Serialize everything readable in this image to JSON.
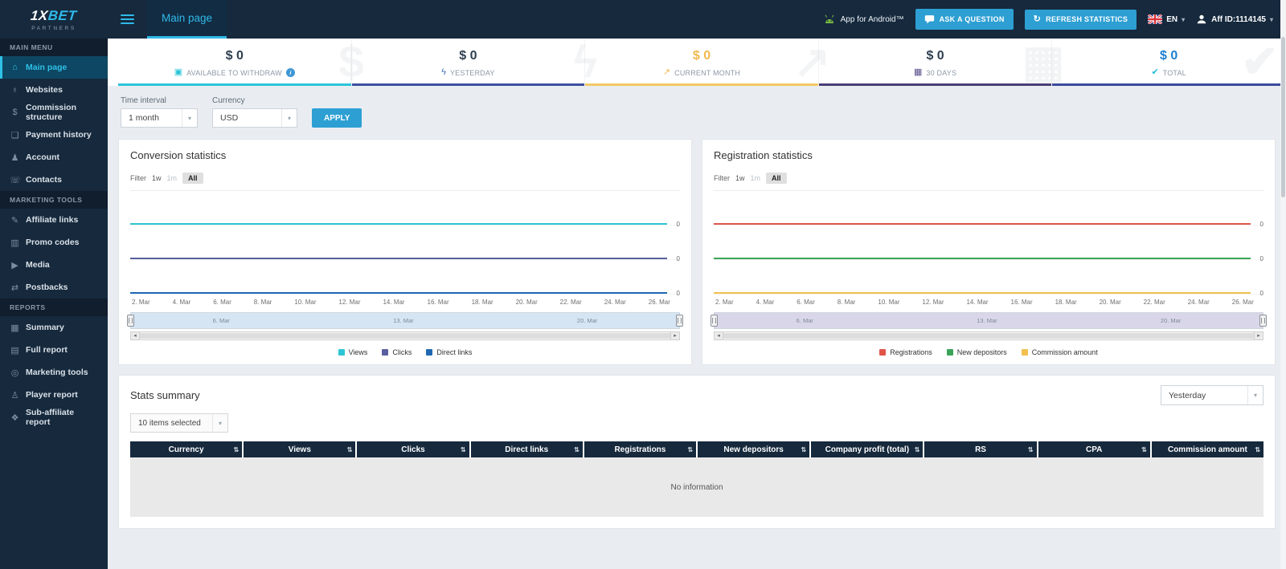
{
  "colors": {
    "accent_cyan": "#2d9fd3",
    "sidebar_bg": "#16293d",
    "active_link": "#2fc0e8",
    "page_bg": "#e9edf1"
  },
  "brand": {
    "name_a": "1X",
    "name_b": "BET",
    "subtitle": "PARTNERS"
  },
  "topbar": {
    "page_title": "Main page",
    "android_label": "App for Android™",
    "ask_question": "ASK A QUESTION",
    "refresh_statistics": "REFRESH STATISTICS",
    "language": "EN",
    "aff_id": "Aff ID:1114145"
  },
  "icons": {
    "caret": "▾",
    "refresh": "↻",
    "sort": "⇅",
    "scroll_left": "◂",
    "scroll_right": "▸"
  },
  "sidebar": {
    "sections": [
      {
        "header": "MAIN MENU",
        "items": [
          {
            "label": "Main page",
            "icon": "home-icon",
            "glyph": "⌂",
            "state": "active"
          },
          {
            "label": "Websites",
            "icon": "globe-icon",
            "glyph": "♁"
          },
          {
            "label": "Commission structure",
            "icon": "dollar-icon",
            "glyph": "$"
          },
          {
            "label": "Payment history",
            "icon": "payment-history-icon",
            "glyph": "❏"
          },
          {
            "label": "Account",
            "icon": "account-icon",
            "glyph": "♟"
          },
          {
            "label": "Contacts",
            "icon": "contacts-icon",
            "glyph": "☏"
          }
        ]
      },
      {
        "header": "MARKETING TOOLS",
        "items": [
          {
            "label": "Affiliate links",
            "icon": "affiliate-links-icon",
            "glyph": "✎"
          },
          {
            "label": "Promo codes",
            "icon": "promo-codes-icon",
            "glyph": "▥"
          },
          {
            "label": "Media",
            "icon": "media-icon",
            "glyph": "▶"
          },
          {
            "label": "Postbacks",
            "icon": "postbacks-icon",
            "glyph": "⇄"
          }
        ]
      },
      {
        "header": "REPORTS",
        "items": [
          {
            "label": "Summary",
            "icon": "summary-icon",
            "glyph": "▦"
          },
          {
            "label": "Full report",
            "icon": "full-report-icon",
            "glyph": "▤"
          },
          {
            "label": "Marketing tools",
            "icon": "marketing-tools-icon",
            "glyph": "◎"
          },
          {
            "label": "Player report",
            "icon": "player-report-icon",
            "glyph": "♙"
          },
          {
            "label": "Sub-affiliate report",
            "icon": "sub-affiliate-report-icon",
            "glyph": "❖"
          }
        ]
      }
    ]
  },
  "cards": [
    {
      "value": "$ 0",
      "label": "AVAILABLE TO WITHDRAW",
      "icon": "withdraw-icon",
      "glyph": "▣",
      "accent": "#2bc4d9",
      "value_color": "#2e3f50",
      "icon_color": "#2bc4d9",
      "info": "i",
      "watermark": "$"
    },
    {
      "value": "$ 0",
      "label": "YESTERDAY",
      "icon": "lightning-icon",
      "glyph": "ϟ",
      "accent": "#3d4f9e",
      "value_color": "#2e3f50",
      "icon_color": "#3f6fb5",
      "watermark": "ϟ"
    },
    {
      "value": "$ 0",
      "label": "CURRENT MONTH",
      "icon": "trend-chart-icon",
      "glyph": "↗",
      "accent": "#f3c965",
      "value_color": "#f0b94f",
      "icon_color": "#f0b94f",
      "watermark": "↗"
    },
    {
      "value": "$ 0",
      "label": "30 DAYS",
      "icon": "calendar-icon",
      "glyph": "▦",
      "accent": "#4a3e78",
      "value_color": "#2e3f50",
      "icon_color": "#5a4e8c",
      "watermark": "▦"
    },
    {
      "value": "$ 0",
      "label": "TOTAL",
      "icon": "check-icon",
      "glyph": "✔",
      "accent": "#3b4a9b",
      "value_color": "#1d7fd0",
      "icon_color": "#20b9db",
      "watermark": "✔"
    }
  ],
  "filters": {
    "time_interval_label": "Time interval",
    "time_interval_value": "1 month",
    "currency_label": "Currency",
    "currency_value": "USD",
    "apply": "APPLY"
  },
  "charts": {
    "filter_label": "Filter",
    "filter_options": [
      {
        "label": "1w"
      },
      {
        "label": "1m",
        "state": "disabled"
      },
      {
        "label": "All",
        "state": "active"
      }
    ],
    "x_labels": [
      "2. Mar",
      "4. Mar",
      "6. Mar",
      "8. Mar",
      "10. Mar",
      "12. Mar",
      "14. Mar",
      "16. Mar",
      "18. Mar",
      "20. Mar",
      "22. Mar",
      "24. Mar",
      "26. Mar"
    ],
    "navigator_labels": [
      "6. Mar",
      "13. Mar",
      "20. Mar"
    ],
    "zero": "0",
    "conversion": {
      "title": "Conversion statistics",
      "series": [
        {
          "label": "Views",
          "color": "#2ec5d3",
          "value": 0
        },
        {
          "label": "Clicks",
          "color": "#5a5f9e",
          "value": 0
        },
        {
          "label": "Direct links",
          "color": "#2168b2",
          "value": 0
        }
      ]
    },
    "registration": {
      "title": "Registration statistics",
      "series": [
        {
          "label": "Registrations",
          "color": "#e05548",
          "value": 0
        },
        {
          "label": "New depositors",
          "color": "#3ba458",
          "value": 0
        },
        {
          "label": "Commission amount",
          "color": "#f2c14e",
          "value": 0
        }
      ]
    }
  },
  "stats": {
    "title": "Stats summary",
    "period_value": "Yesterday",
    "items_selected": "10 items selected",
    "columns": [
      {
        "label": "Currency"
      },
      {
        "label": "Views"
      },
      {
        "label": "Clicks"
      },
      {
        "label": "Direct links"
      },
      {
        "label": "Registrations"
      },
      {
        "label": "New depositors"
      },
      {
        "label": "Company profit (total)"
      },
      {
        "label": "RS"
      },
      {
        "label": "CPA"
      },
      {
        "label": "Commission amount"
      }
    ],
    "empty_text": "No information"
  }
}
